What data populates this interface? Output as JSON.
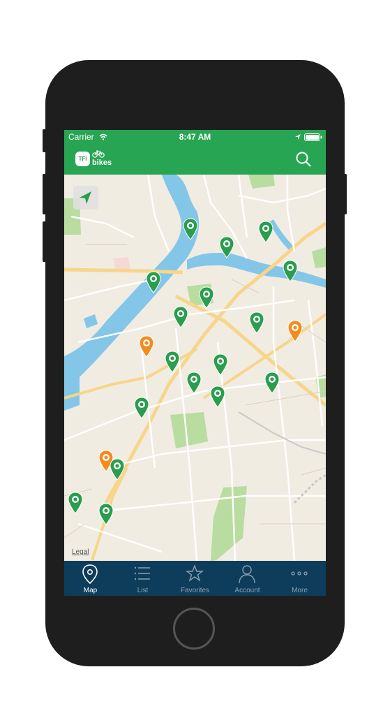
{
  "status_bar": {
    "carrier": "Carrier",
    "time": "8:47 AM"
  },
  "header": {
    "logo_badge": "TFI",
    "logo_text": "bikes",
    "search_icon": "search-icon"
  },
  "map": {
    "legal": "Legal",
    "location_button_icon": "location-arrow-icon",
    "station_pins": [
      {
        "status": "available",
        "color": "#2a9d4e"
      },
      {
        "status": "available",
        "color": "#2a9d4e"
      },
      {
        "status": "available",
        "color": "#2a9d4e"
      },
      {
        "status": "available",
        "color": "#2a9d4e"
      },
      {
        "status": "available",
        "color": "#2a9d4e"
      },
      {
        "status": "available",
        "color": "#2a9d4e"
      },
      {
        "status": "available",
        "color": "#2a9d4e"
      },
      {
        "status": "available",
        "color": "#2a9d4e"
      },
      {
        "status": "low",
        "color": "#f28c1e"
      },
      {
        "status": "low",
        "color": "#f28c1e"
      },
      {
        "status": "available",
        "color": "#2a9d4e"
      },
      {
        "status": "available",
        "color": "#2a9d4e"
      },
      {
        "status": "available",
        "color": "#2a9d4e"
      },
      {
        "status": "available",
        "color": "#2a9d4e"
      },
      {
        "status": "available",
        "color": "#2a9d4e"
      },
      {
        "status": "available",
        "color": "#2a9d4e"
      },
      {
        "status": "low",
        "color": "#f28c1e"
      },
      {
        "status": "available",
        "color": "#2a9d4e"
      },
      {
        "status": "available",
        "color": "#2a9d4e"
      },
      {
        "status": "available",
        "color": "#2a9d4e"
      },
      {
        "status": "low",
        "color": "#f28c1e"
      }
    ]
  },
  "tabs": [
    {
      "label": "Map",
      "icon": "map-pin-icon",
      "active": true
    },
    {
      "label": "List",
      "icon": "list-icon",
      "active": false
    },
    {
      "label": "Favorites",
      "icon": "star-icon",
      "active": false
    },
    {
      "label": "Account",
      "icon": "person-icon",
      "active": false
    },
    {
      "label": "More",
      "icon": "more-dots-icon",
      "active": false
    }
  ],
  "colors": {
    "brand_green": "#27a553",
    "tab_bar": "#0d3d5b",
    "water": "#84c6e8",
    "park": "#b9dca0"
  }
}
